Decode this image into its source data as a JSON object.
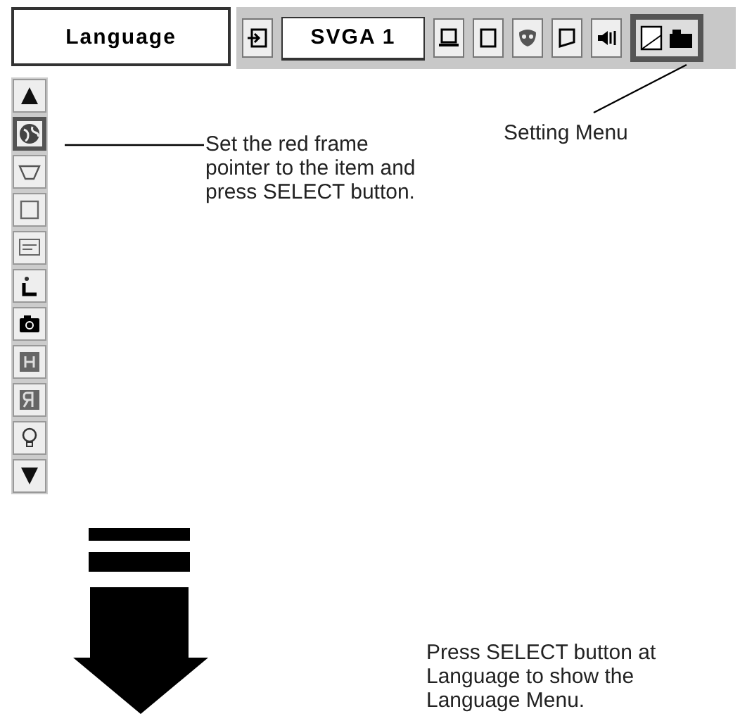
{
  "menu_title": "Language",
  "toolbar": [
    {
      "kind": "icon",
      "selected": false
    },
    {
      "kind": "label",
      "text": "SVGA 1"
    },
    {
      "kind": "icon",
      "selected": false
    },
    {
      "kind": "icon",
      "selected": false
    },
    {
      "kind": "icon",
      "selected": false
    },
    {
      "kind": "icon",
      "selected": false
    },
    {
      "kind": "icon",
      "selected": false
    },
    {
      "kind": "icon",
      "selected": true
    }
  ],
  "sidebar": {
    "items": [
      {
        "selected": true
      },
      {
        "selected": false
      },
      {
        "selected": false
      },
      {
        "selected": false
      },
      {
        "selected": false
      },
      {
        "selected": false
      },
      {
        "selected": false
      },
      {
        "selected": false
      },
      {
        "selected": false
      }
    ]
  },
  "callouts": [
    {
      "text": "Set the red frame pointer to the item and press SELECT button."
    },
    {
      "text": "Setting Menu"
    },
    {
      "text": "Press SELECT button at Language to show the Language Menu."
    }
  ]
}
